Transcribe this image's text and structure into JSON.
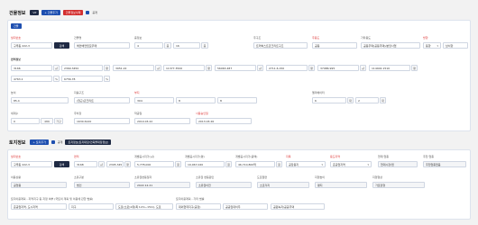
{
  "building": {
    "title": "건물정보",
    "btn_ref": "VP",
    "btn_add": "+ 건물추가",
    "btn_delete": "건물정보삭제",
    "check_label": "공개",
    "small_btn": "건물",
    "lot": {
      "label": "필지번호",
      "value": "구루동 222-3",
      "search": "검색"
    },
    "bname": {
      "label": "건물명",
      "value": "해안배연립모뚜매"
    },
    "floors": {
      "label": "층정보",
      "below_value": "4",
      "below_unit": "층",
      "above_value": "16",
      "above_unit": "층"
    },
    "addr": {
      "label": "주구조",
      "value": "트러벅스트콘크리트구조"
    },
    "usage": {
      "label": "주용도",
      "value": "공동"
    },
    "eqtype": {
      "label": "기타용도",
      "value": "공동주택(공동주택)/분당사업"
    },
    "dir": {
      "label": "방향",
      "value1": "동향",
      "value2": "남서향"
    },
    "area_title": "면적정보",
    "area": [
      {
        "value": "3166",
        "unit": "㎡"
      },
      {
        "value": "2369.3450",
        "unit": "평"
      },
      {
        "value": "3951.22",
        "unit": "㎡"
      },
      {
        "value": "11377.3500",
        "unit": "평"
      },
      {
        "value": "56063.487",
        "unit": "㎡"
      },
      {
        "value": "2711.6.150",
        "unit": "평"
      },
      {
        "value": "37986.995",
        "unit": "㎡"
      },
      {
        "value": "114402.1510",
        "unit": "평"
      }
    ],
    "ratio": [
      {
        "value": "4763.1",
        "unit": "%"
      },
      {
        "value": "6756.78",
        "unit": "%"
      }
    ],
    "r3": {
      "c1": {
        "label": "높이",
        "value": "85.4"
      },
      "c2": {
        "label": "지붕구조",
        "value": "(철근)콘크리트"
      },
      "c3": {
        "label": "부지",
        "values": [
          "304",
          "8",
          "8"
        ]
      },
      "c4": {
        "label": "엘리베이터",
        "values": [
          "6",
          "2"
        ],
        "units": [
          "대",
          "대"
        ]
      }
    },
    "r4": {
      "c1": {
        "label": "세대수",
        "value": "0",
        "mid": "486",
        "unit": "가구"
      },
      "c2": {
        "label": "주차장",
        "value": "1630.6120"
      },
      "c3": {
        "label": "착공일",
        "value": "2010.03.22"
      },
      "c4": {
        "label": "사용승인일",
        "value": "2013.03.26"
      }
    }
  },
  "land": {
    "title": "토지정보",
    "btn_add": "+ 토지추가",
    "check_label": "공개",
    "tag": "토지정보(토지대장/건축물대장정보)",
    "r1": {
      "lot": {
        "label": "필지번호",
        "value": "구루동 222-3",
        "search": "검색"
      },
      "area": {
        "label": "면적",
        "value1": "3168",
        "unit1": "㎡",
        "value2": "2395.345",
        "unit2": "평"
      },
      "price1": {
        "label": "개별공시지가(㎡)",
        "value": "5,778,000",
        "unit": "원"
      },
      "price2": {
        "label": "개별공시지가(평)",
        "value": "19,067,020",
        "unit": "원"
      },
      "price3": {
        "label": "개별공시지가(총액)",
        "value": "46,710,800억",
        "unit": "원"
      },
      "jimok": {
        "label": "지목",
        "value": "공장용지"
      },
      "zone": {
        "label": "용도지역",
        "value": "준공업지역"
      },
      "cur_use": {
        "label": "현재 업종",
        "value": "현대시장/업"
      },
      "main_use": {
        "label": "추천 업종",
        "value": "추천업종없음"
      }
    },
    "r2": {
      "c1": {
        "label": "이용상황",
        "value": "공업용"
      },
      "c2": {
        "label": "소유구분",
        "value": "법인"
      },
      "c3": {
        "label": "소유권변동일자",
        "value": "2022.12.21"
      },
      "c4": {
        "label": "소유권 변동원인",
        "value": "소유권이전"
      },
      "c5": {
        "label": "도로접면",
        "value": "소로각지"
      },
      "c6": {
        "label": "지형높이",
        "value": "평지"
      },
      "c7": {
        "label": "지형형상",
        "value": "가로장형"
      }
    },
    "r3": {
      "label_a": "토지이용계획 - 지역지구 등 지정 여부 (국토의 계획 및 이용에 관한 법률)",
      "label_b": "토지이용계획 - 기타 법률",
      "values": [
        "준공업지역, 도시지역",
        "지구",
        "도로(소로)1류(폭 12m~15m), 도로",
        "대외협력지구(공장)",
        "공공임대이주",
        "공원녹지/공공주택"
      ]
    }
  }
}
